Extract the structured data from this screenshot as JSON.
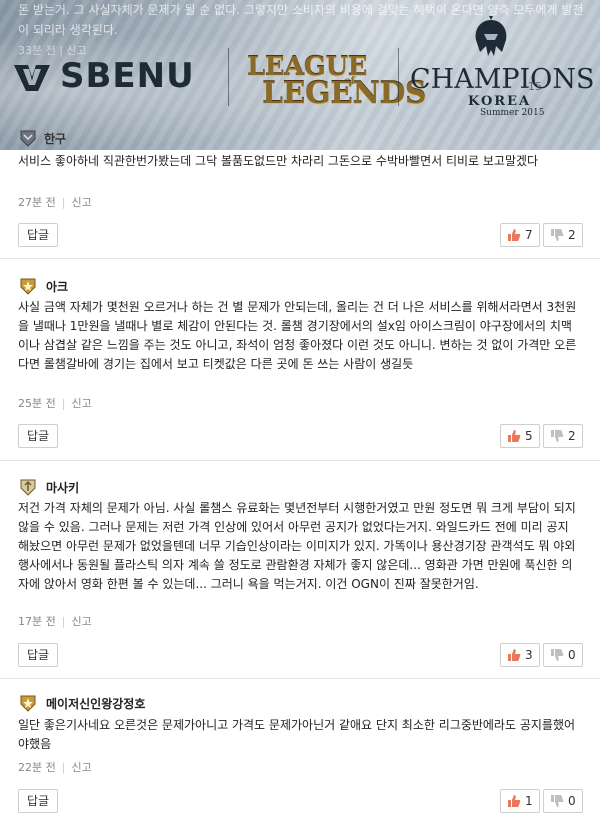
{
  "banner": {
    "faded_text": "돈 받는거. 그 사실자체가 문제가 될 순 없다. 그렇지만 소비자의 비용에 걸맞는 혜택이 온다면 양측 모두에게 발전이 되리라 생각된다.",
    "faded_meta": "33분 전 | 신고",
    "ghost_count": "15",
    "brand_sbenu": "SBENU",
    "lol_line1": "LEAGUE",
    "lol_line2": "LEGENDS",
    "lol_of": "of",
    "champ_title": "CHAMPIONS",
    "champ_sub": "KOREA",
    "champ_season": "Summer 2015"
  },
  "comments": [
    {
      "username": "한구",
      "text": "서비스 좋아하네 직관한번가봤는데 그닥 볼품도없드만 차라리 그돈으로 수박바빨면서 티비로 보고말겠다",
      "time": "27분 전",
      "report": "신고",
      "reply": "답글",
      "likes": "7",
      "dislikes": "2"
    },
    {
      "username": "아크",
      "text": "사실 금액 자체가 몇천원 오르거나 하는 건 별 문제가 안되는데, 올리는 건 더 나은 서비스를 위해서라면서 3천원을 낼때나 1만원을 낼때나 별로 체감이 안된다는 것. 롤챔 경기장에서의 설x임 아이스크림이 야구장에서의 치맥이나 삼겹살 같은 느낌을 주는 것도 아니고, 좌석이 엄청 좋아졌다 이런 것도 아니니. 변하는 것 없이 가격만 오른다면 롤챔갈바에 경기는 집에서 보고 티켓값은 다른 곳에 돈 쓰는 사람이 생길듯",
      "time": "25분 전",
      "report": "신고",
      "reply": "답글",
      "likes": "5",
      "dislikes": "2"
    },
    {
      "username": "마사키",
      "text": "저건 가격 자체의 문제가 아님. 사실 롤챔스 유료화는 몇년전부터 시행한거였고 만원 정도면 뭐 크게 부담이 되지 않을 수 있음. 그러나 문제는 저런 가격 인상에 있어서 아무런 공지가 없었다는거지. 와일드카드 전에 미리 공지해놨으면 아무런 문제가 없었을텐데 너무 기습인상이라는 이미지가 있지. 가똑이나 용산경기장 관객석도 뭐 야외행사에서나 동원될 플라스틱 의자 계속 쓸 정도로 관람환경 자체가 좋지 않은데... 영화관 가면 만원에 푹신한 의자에 앉아서 영화 한편 볼 수 있는데... 그러니 욕을 먹는거지. 이건 OGN이 진짜 잘못한거임.",
      "time": "17분 전",
      "report": "신고",
      "reply": "답글",
      "likes": "3",
      "dislikes": "0"
    },
    {
      "username": "메이저신인왕강정호",
      "text": "일단 좋은기사네요 오른것은 문제가아니고 가격도 문제가아닌거 같애요 단지 최소한 리그중반에라도 공지를했어야했음",
      "time": "22분 전",
      "report": "신고",
      "reply": "답글",
      "likes": "1",
      "dislikes": "0"
    }
  ],
  "colors": {
    "banner_base": "#a7b4c0",
    "logo_dark": "#1e2a36",
    "lol_gold": "#8a6a2a",
    "badge_gold": "#c89a3a",
    "border": "#cfcfcf"
  }
}
